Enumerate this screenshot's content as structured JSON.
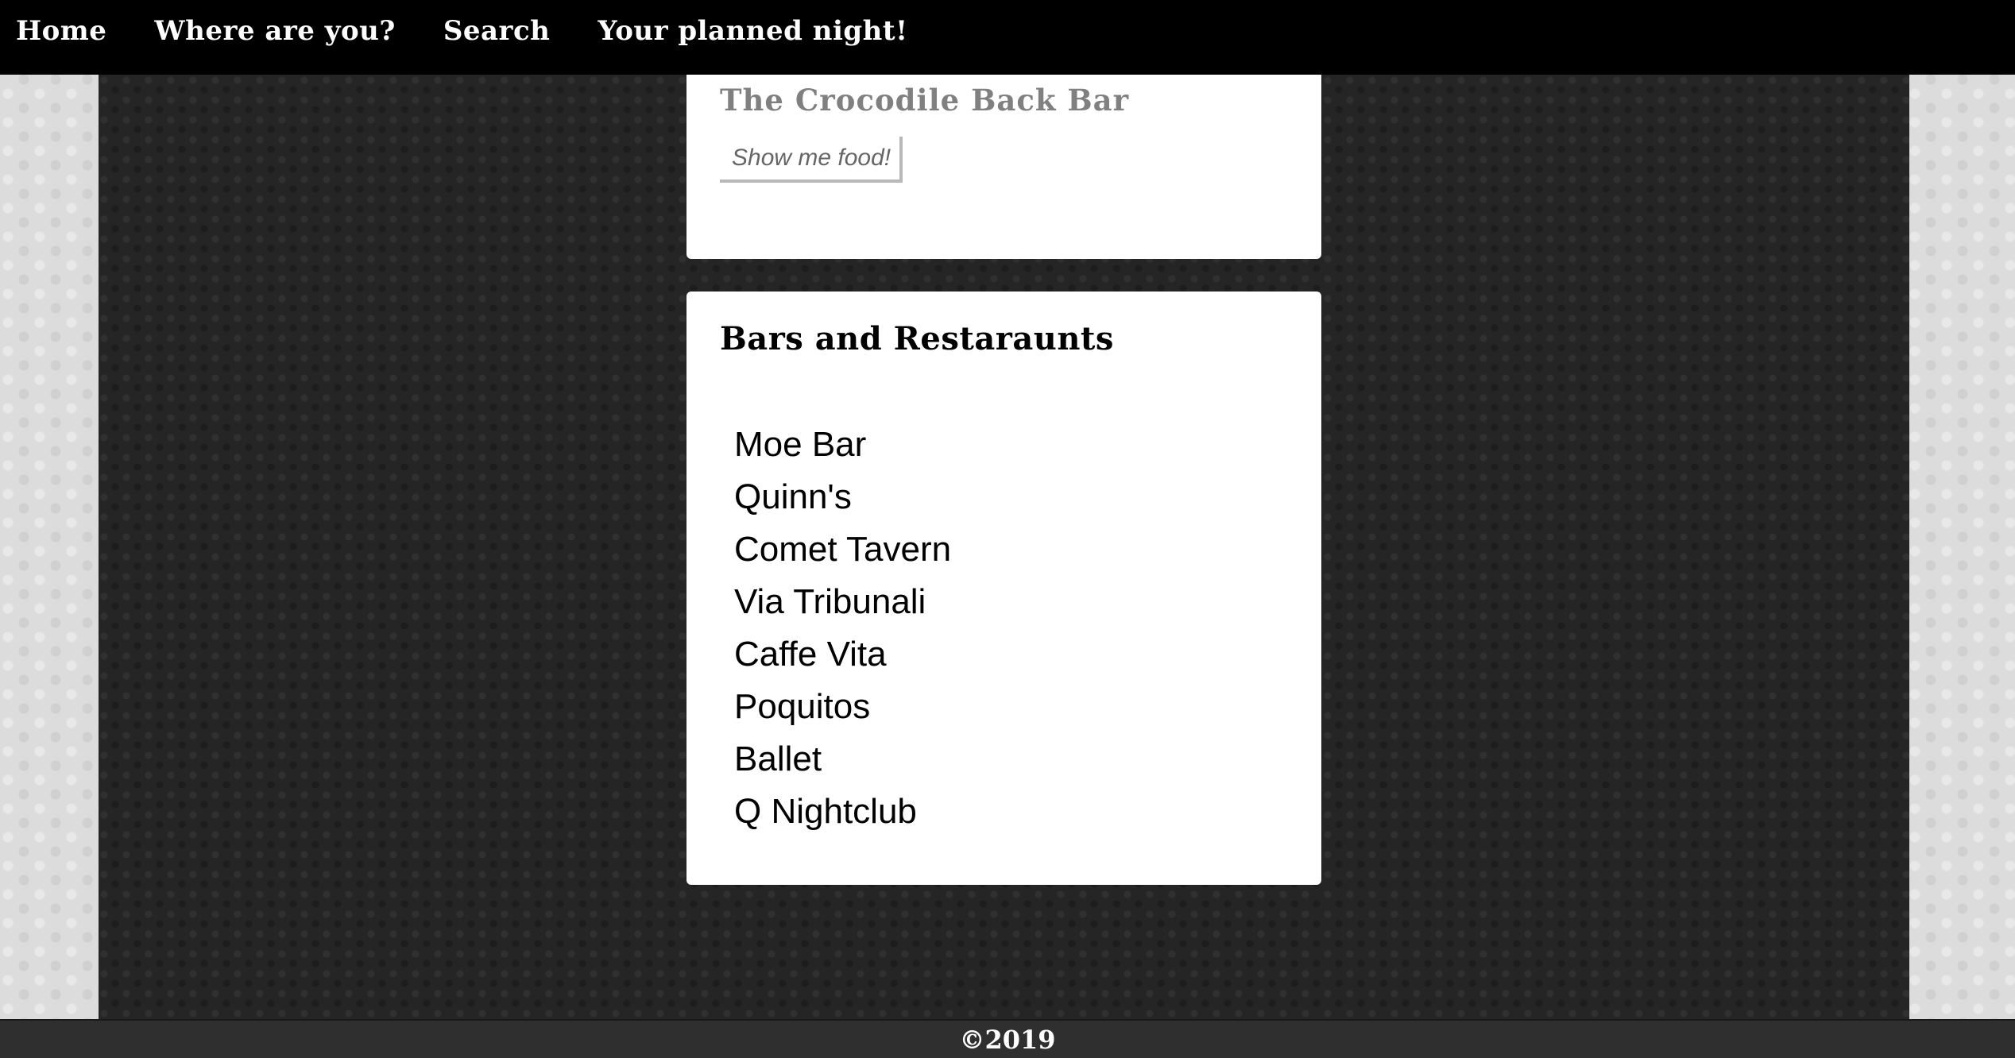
{
  "nav": {
    "items": [
      {
        "label": "Home"
      },
      {
        "label": "Where are you?"
      },
      {
        "label": "Search"
      },
      {
        "label": "Your planned night!"
      }
    ]
  },
  "selected_venue": {
    "name": "The Crocodile Back Bar",
    "button_label": "Show me food!"
  },
  "bars_card": {
    "heading": "Bars and Restaraunts",
    "items": [
      {
        "name": "Moe Bar"
      },
      {
        "name": "Quinn's"
      },
      {
        "name": "Comet Tavern"
      },
      {
        "name": "Via Tribunali"
      },
      {
        "name": "Caffe Vita"
      },
      {
        "name": "Poquitos"
      },
      {
        "name": "Ballet"
      },
      {
        "name": "Q Nightclub"
      }
    ]
  },
  "footer": {
    "text": "©2019"
  },
  "colors": {
    "navbar": "#000000",
    "panel": "#252525",
    "outer_background": "#dcdcdc",
    "card": "#ffffff",
    "muted_title": "#808080"
  }
}
